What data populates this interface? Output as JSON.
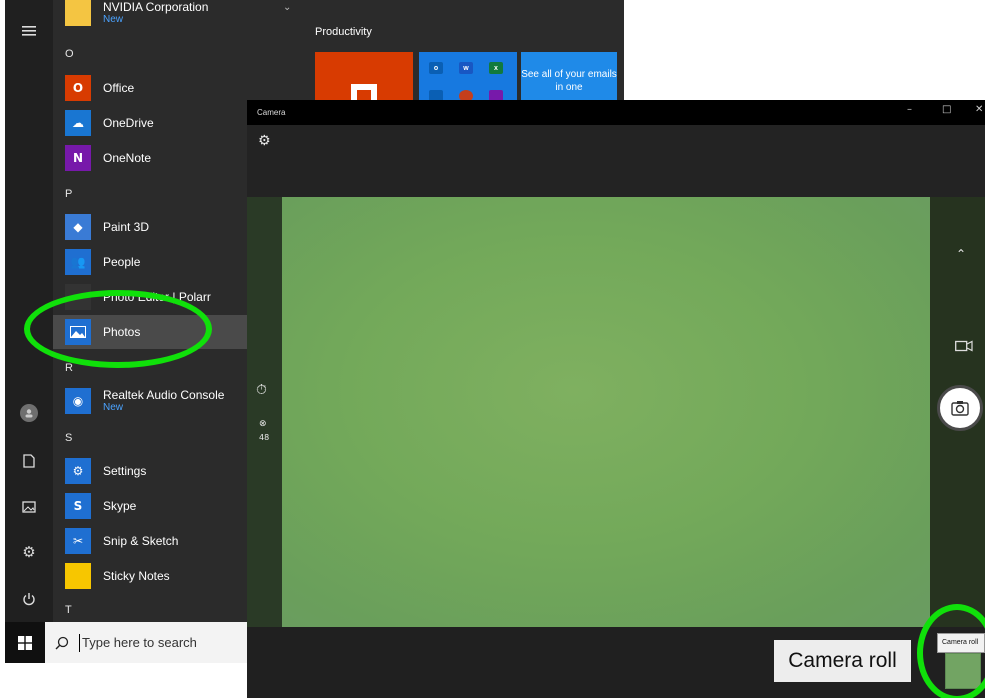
{
  "start_menu": {
    "letters": [
      "O",
      "P",
      "R",
      "S",
      "T"
    ],
    "apps": [
      {
        "name": "NVIDIA Corporation",
        "badge": "New",
        "icon": "folder-icon",
        "color": "#f4c542"
      },
      {
        "name": "Office",
        "badge": "",
        "icon": "office-icon",
        "color": "#d83b01"
      },
      {
        "name": "OneDrive",
        "badge": "",
        "icon": "onedrive-icon",
        "color": "#1976d2"
      },
      {
        "name": "OneNote",
        "badge": "",
        "icon": "onenote-icon",
        "color": "#7719aa"
      },
      {
        "name": "Paint 3D",
        "badge": "",
        "icon": "paint3d-icon",
        "color": "#3a7bd5"
      },
      {
        "name": "People",
        "badge": "",
        "icon": "people-icon",
        "color": "#1f6fd1"
      },
      {
        "name": "Photo Editor | Polarr",
        "badge": "",
        "icon": "polarr-icon",
        "color": "#333333"
      },
      {
        "name": "Photos",
        "badge": "",
        "icon": "photos-icon",
        "color": "#1f6fd1"
      },
      {
        "name": "Realtek Audio Console",
        "badge": "New",
        "icon": "realtek-icon",
        "color": "#1f6fd1"
      },
      {
        "name": "Settings",
        "badge": "",
        "icon": "gear-icon",
        "color": "#1f6fd1"
      },
      {
        "name": "Skype",
        "badge": "",
        "icon": "skype-icon",
        "color": "#1f6fd1"
      },
      {
        "name": "Snip & Sketch",
        "badge": "",
        "icon": "snip-icon",
        "color": "#1f6fd1"
      },
      {
        "name": "Sticky Notes",
        "badge": "",
        "icon": "sticky-notes-icon",
        "color": "#f7c600"
      }
    ],
    "tiles": {
      "group_title": "Productivity",
      "email_tile": "See all of your emails in one"
    }
  },
  "taskbar": {
    "search_placeholder": "Type here to search"
  },
  "camera": {
    "window_title": "Camera",
    "timer_value": "48",
    "camera_roll_label": "Camera roll",
    "tooltip": "Camera roll"
  },
  "colors": {
    "annotation_ring": "#10e00a",
    "accent": "#1f6fd1"
  }
}
